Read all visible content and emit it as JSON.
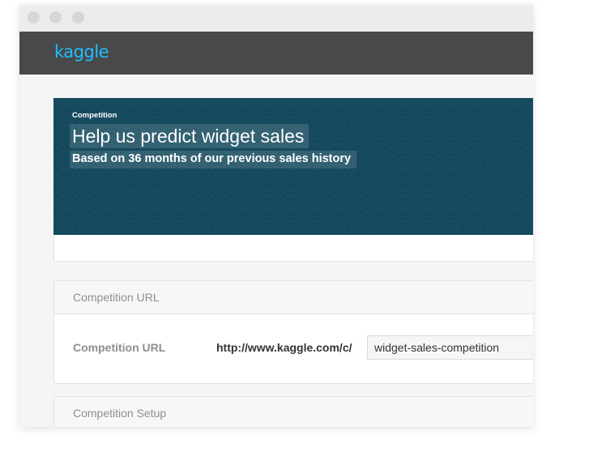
{
  "app": {
    "logo_text": "kaggle",
    "brand_color": "#20beff",
    "navbar_color": "#47494b",
    "hero_color": "#154a5e"
  },
  "hero": {
    "kicker": "Competition",
    "title": "Help us predict widget sales",
    "subtitle": "Based on 36 months of our previous sales history"
  },
  "url_panel": {
    "header": "Competition URL",
    "field_label": "Competition URL",
    "url_prefix": "http://www.kaggle.com/c/",
    "slug_value": "widget-sales-competition"
  },
  "setup_panel": {
    "header": "Competition Setup"
  }
}
